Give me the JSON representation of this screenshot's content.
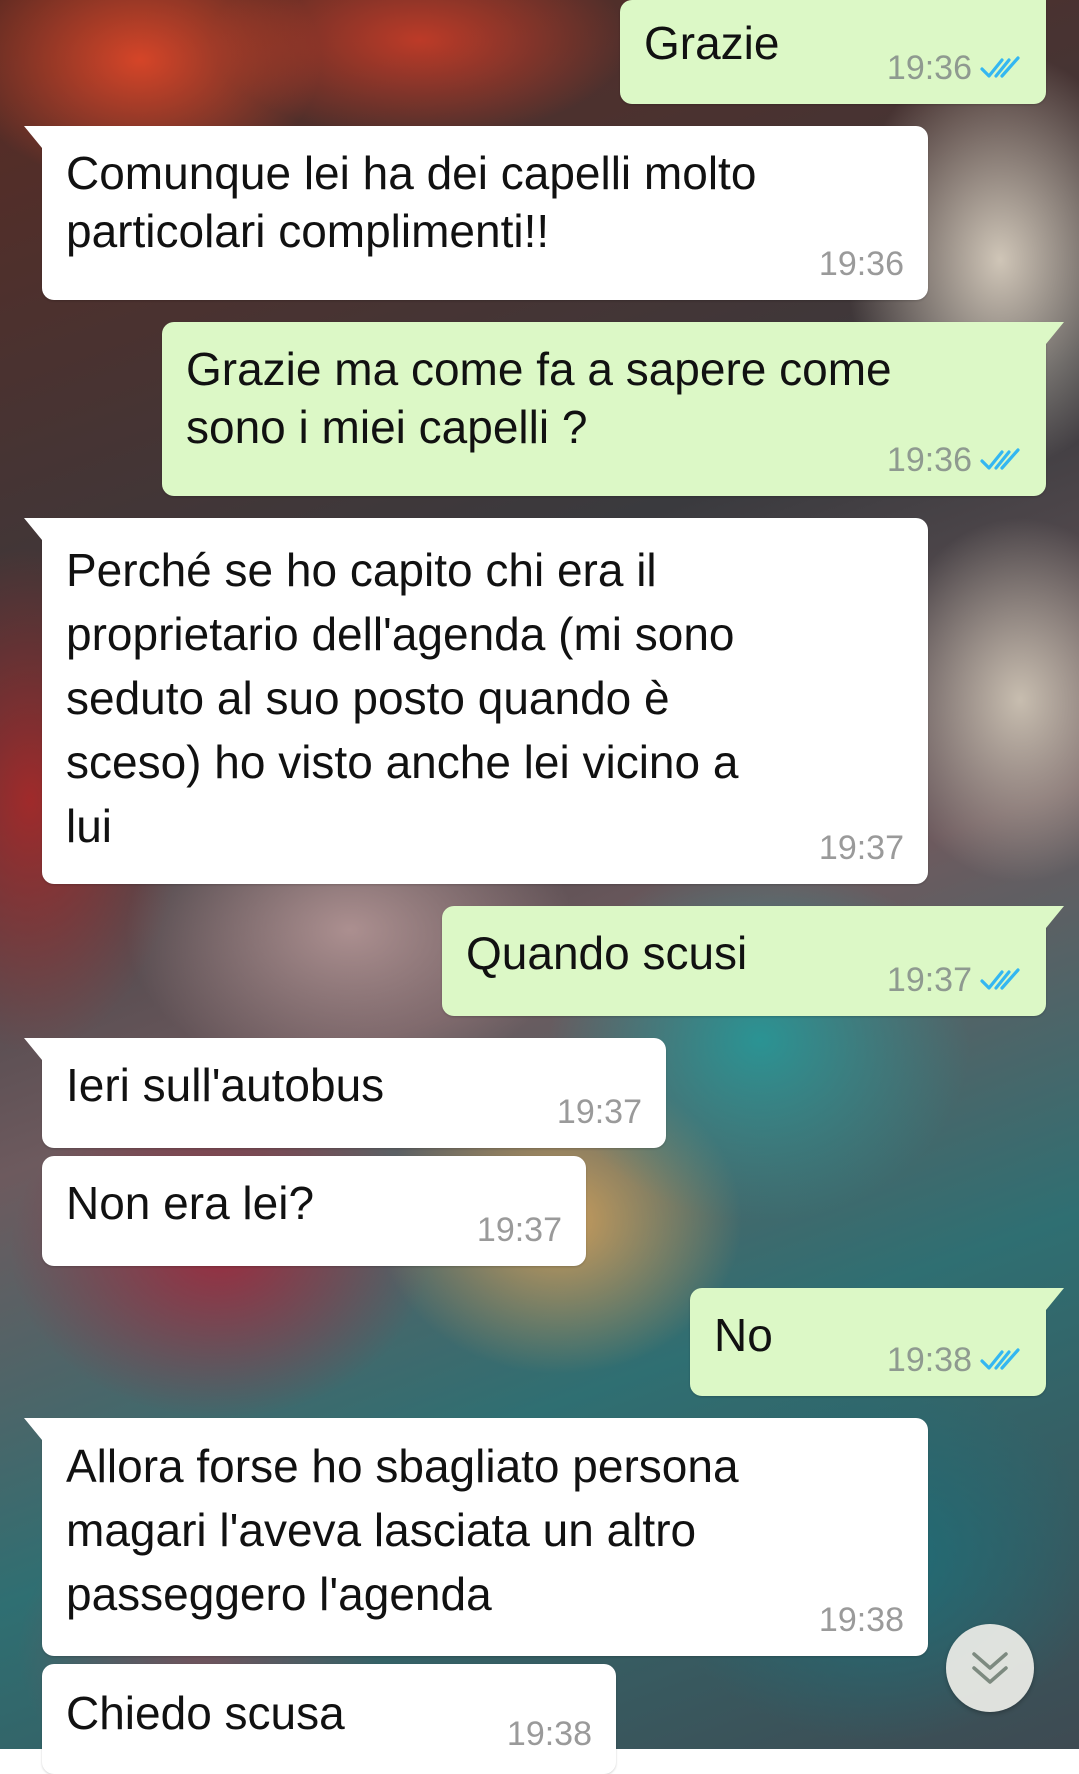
{
  "messages": [
    {
      "direction": "out",
      "text": "Grazie",
      "time": "19:36",
      "status_icon": "double-check-icon"
    },
    {
      "direction": "in",
      "text": "Comunque lei ha dei capelli molto\nparticolari complimenti!!",
      "time": "19:36"
    },
    {
      "direction": "out",
      "text": "Grazie ma come fa a sapere come\nsono i miei capelli ?",
      "time": "19:36",
      "status_icon": "double-check-icon"
    },
    {
      "direction": "in",
      "text": "Perché se ho capito chi era il\nproprietario dell'agenda (mi sono\nseduto al suo posto quando è\nsceso) ho visto anche lei vicino a\nlui",
      "time": "19:37"
    },
    {
      "direction": "out",
      "text": "Quando scusi",
      "time": "19:37",
      "status_icon": "double-check-icon"
    },
    {
      "direction": "in",
      "text": "Ieri sull'autobus",
      "time": "19:37"
    },
    {
      "direction": "in",
      "text": "Non era lei?",
      "time": "19:37"
    },
    {
      "direction": "out",
      "text": "No",
      "time": "19:38",
      "status_icon": "double-check-icon"
    },
    {
      "direction": "in",
      "text": "Allora forse ho sbagliato persona\nmagari l'aveva lasciata un altro\npasseggero l'agenda",
      "time": "19:38"
    },
    {
      "direction": "in",
      "text": "Chiedo scusa",
      "time": "19:38"
    }
  ],
  "scroll_button": {
    "icon": "chevron-double-down-icon"
  },
  "colors": {
    "outgoing_bubble": "#dcf8c6",
    "incoming_bubble": "#ffffff",
    "read_check": "#34b7f1",
    "timestamp": "#9a9a9a"
  }
}
